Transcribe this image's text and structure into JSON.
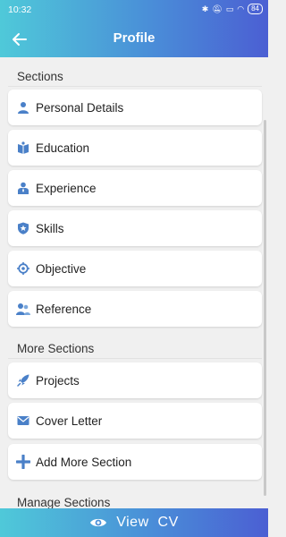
{
  "status_bar": {
    "time": "10:32",
    "battery": "84"
  },
  "header": {
    "title": "Profile"
  },
  "sections": {
    "title": "Sections",
    "items": [
      {
        "label": "Personal Details",
        "icon": "person-icon"
      },
      {
        "label": "Education",
        "icon": "book-icon"
      },
      {
        "label": "Experience",
        "icon": "professional-icon"
      },
      {
        "label": "Skills",
        "icon": "shield-star-icon"
      },
      {
        "label": "Objective",
        "icon": "target-icon"
      },
      {
        "label": "Reference",
        "icon": "people-icon"
      }
    ]
  },
  "more_sections": {
    "title": "More Sections",
    "items": [
      {
        "label": "Projects",
        "icon": "rocket-icon"
      },
      {
        "label": "Cover Letter",
        "icon": "envelope-icon"
      },
      {
        "label": "Add More Section",
        "icon": "plus-icon"
      }
    ]
  },
  "manage_sections": {
    "title": "Manage Sections"
  },
  "bottom_bar": {
    "label": "View  CV",
    "icon": "eye-icon"
  },
  "colors": {
    "gradient_start": "#4fc9d9",
    "gradient_end": "#4b5fd3",
    "icon_blue": "#4a80c8"
  }
}
